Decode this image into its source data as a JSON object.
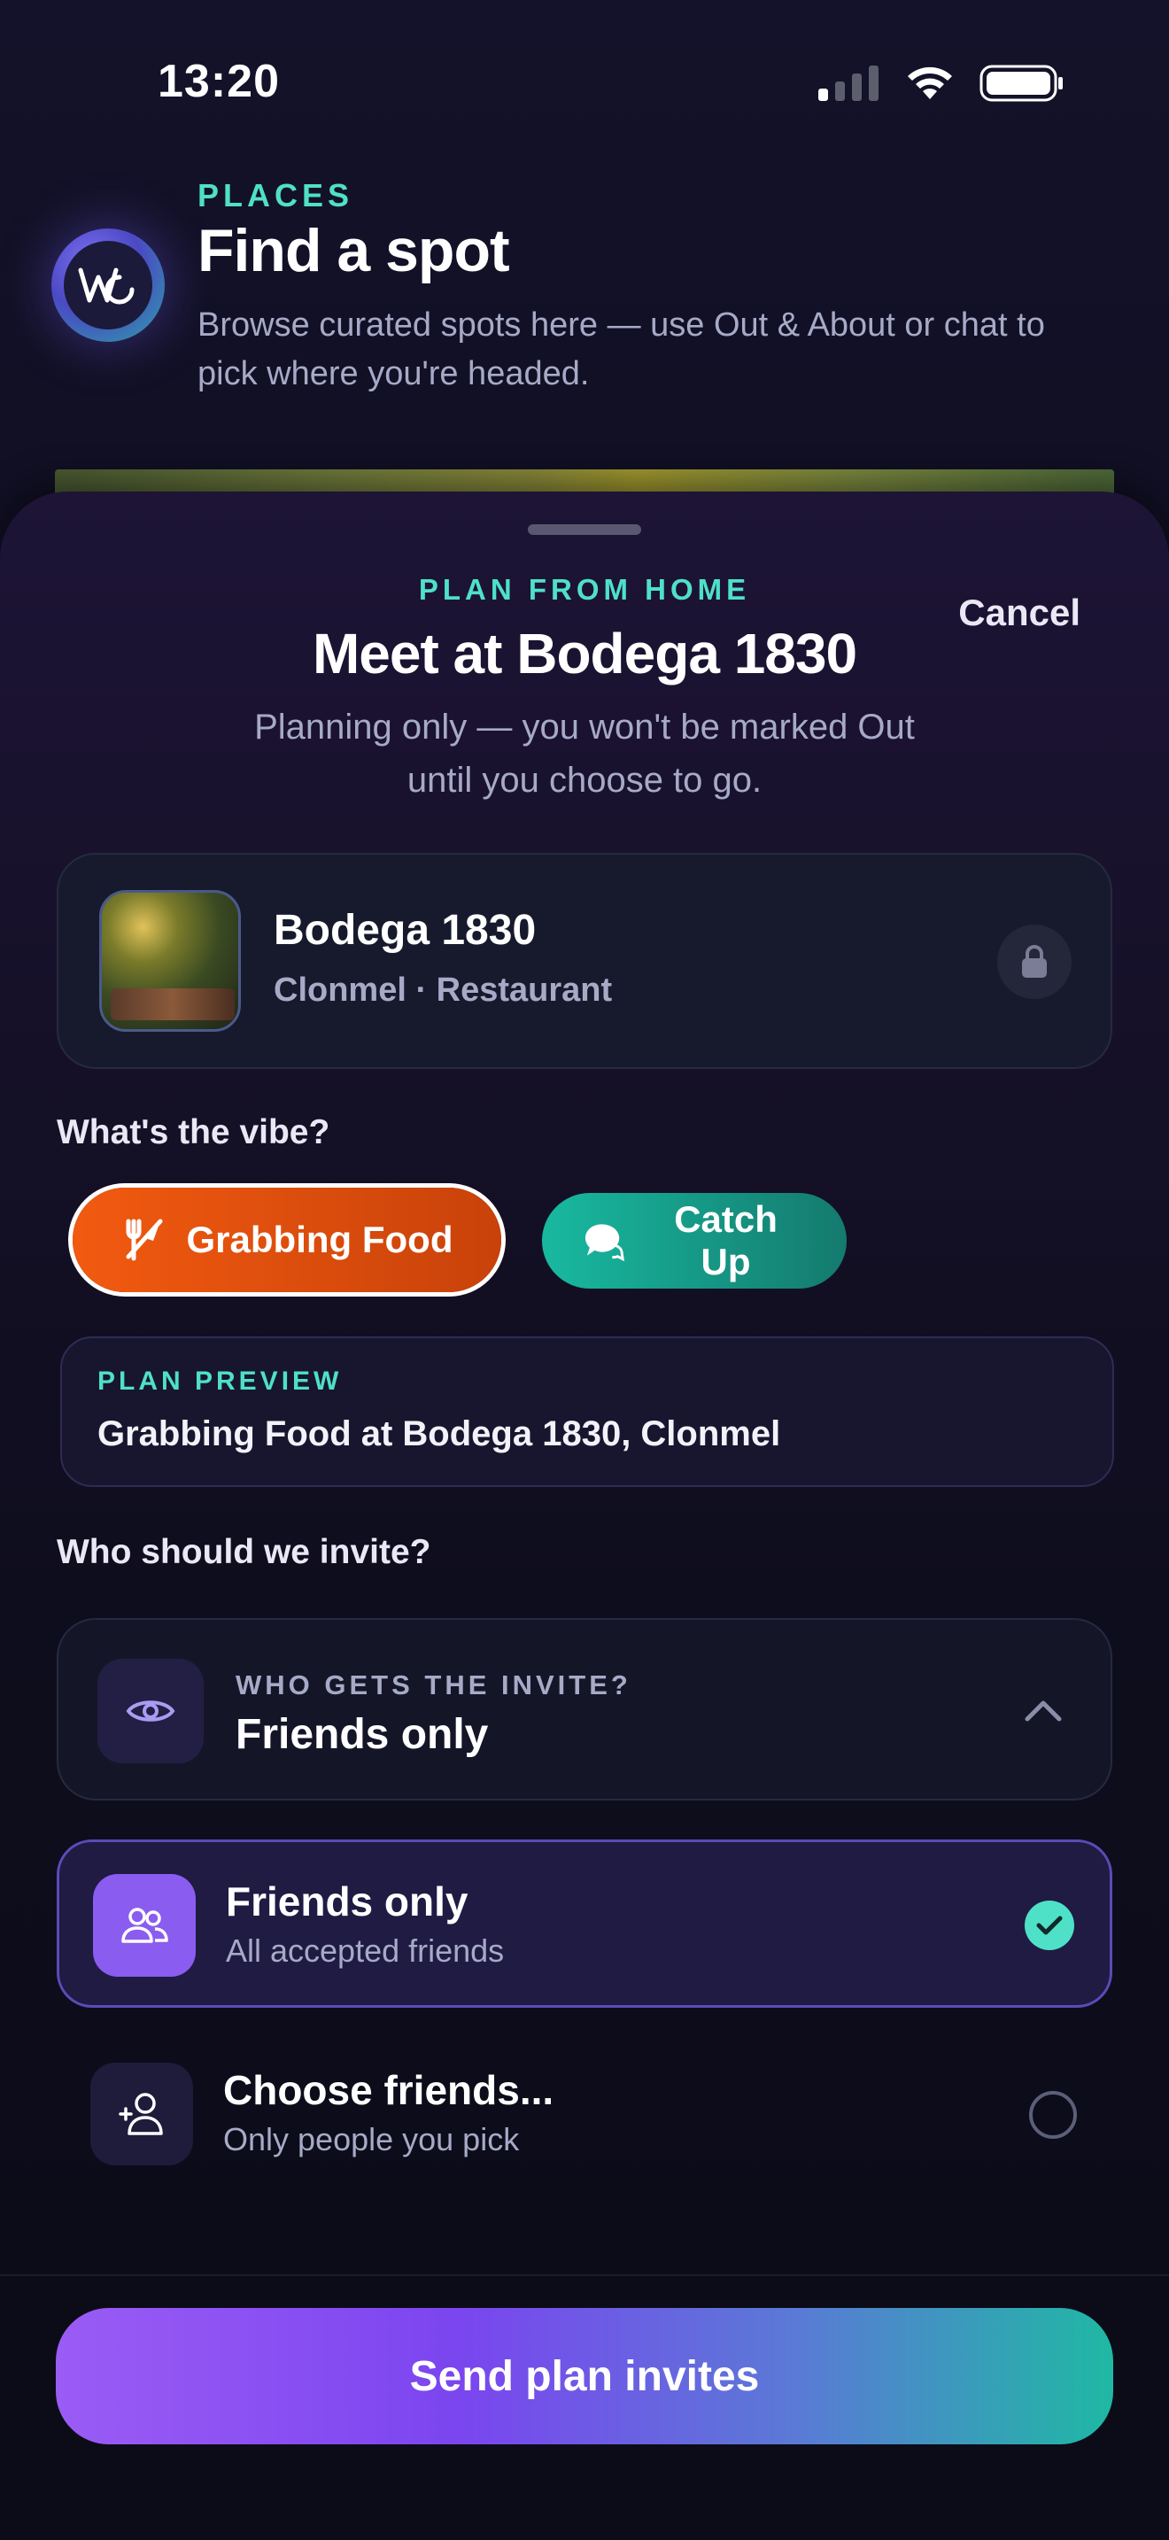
{
  "status_bar": {
    "time": "13:20"
  },
  "background_page": {
    "eyebrow": "PLACES",
    "title": "Find a spot",
    "description": "Browse curated spots here — use Out & About or chat to pick where you're headed."
  },
  "sheet": {
    "eyebrow": "PLAN FROM HOME",
    "title": "Meet at Bodega 1830",
    "subtitle": "Planning only — you won't be marked Out until you choose to go.",
    "cancel_label": "Cancel",
    "place": {
      "name": "Bodega 1830",
      "meta": "Clonmel · Restaurant"
    },
    "vibe": {
      "label": "What's the vibe?",
      "options": [
        {
          "label": "Grabbing Food",
          "icon": "utensils-icon",
          "selected": true,
          "color": "#f25a10"
        },
        {
          "label": "Catch Up",
          "icon": "chat-bubbles-icon",
          "selected": false,
          "color": "#18b9a0"
        }
      ]
    },
    "preview": {
      "eyebrow": "PLAN PREVIEW",
      "text": "Grabbing Food at Bodega 1830, Clonmel"
    },
    "invite": {
      "label": "Who should we invite?",
      "selector_eyebrow": "WHO GETS THE INVITE?",
      "selector_value": "Friends only",
      "options": [
        {
          "title": "Friends only",
          "subtitle": "All accepted friends",
          "icon": "people-icon",
          "selected": true
        },
        {
          "title": "Choose friends...",
          "subtitle": "Only people you pick",
          "icon": "add-person-icon",
          "selected": false
        }
      ]
    },
    "cta_label": "Send plan invites"
  },
  "colors": {
    "accent_teal": "#4fe0c8",
    "accent_purple": "#8a5cf0",
    "accent_orange": "#f25a10"
  }
}
